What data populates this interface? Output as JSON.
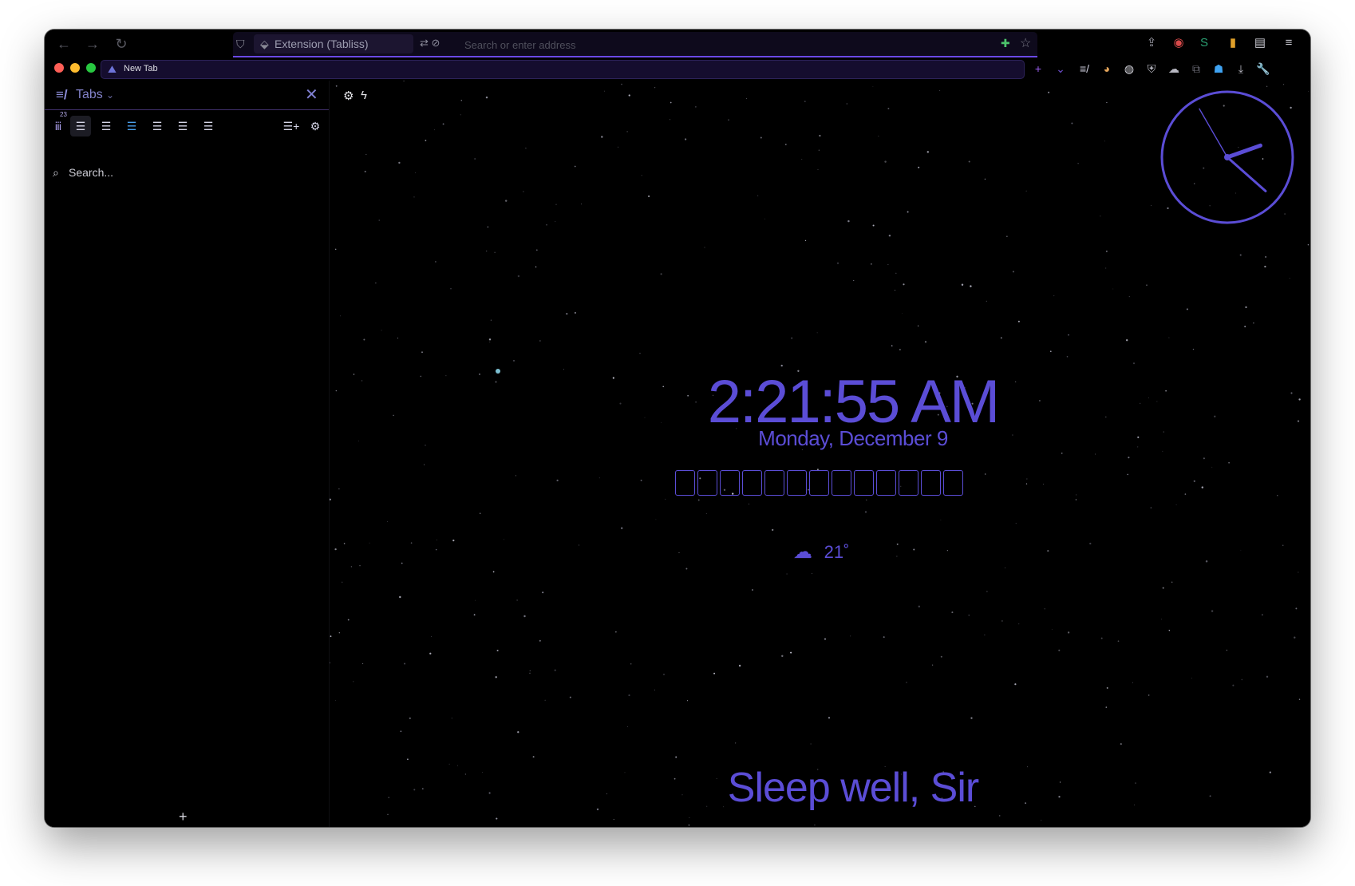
{
  "window": {
    "toolbar": {
      "identity_label": "Extension (Tabliss)",
      "address_placeholder": "Search or enter address"
    },
    "tab": {
      "title": "New Tab"
    }
  },
  "sidebar": {
    "title": "Tabs",
    "badge_count": "23",
    "search_placeholder": "Search...",
    "add_label": "+"
  },
  "newtab": {
    "time": "2:21:55 AM",
    "date": "Monday, December 9",
    "temperature": "21˚",
    "greeting": "Sleep well, Sir",
    "accent_color": "#5b4dd6",
    "analog_clock": {
      "hours": 2,
      "minutes": 21,
      "seconds": 55
    }
  },
  "icons": [
    "back-icon",
    "forward-icon",
    "reload-icon",
    "shield-icon",
    "extension-icon",
    "permissions-icon",
    "puzzle-icon",
    "star-icon",
    "share-icon",
    "browser-extension-icons",
    "menu-icon",
    "settings-icon",
    "lightning-icon",
    "cloud-icon",
    "trash-icon",
    "bookmark-icon",
    "history-icon"
  ]
}
